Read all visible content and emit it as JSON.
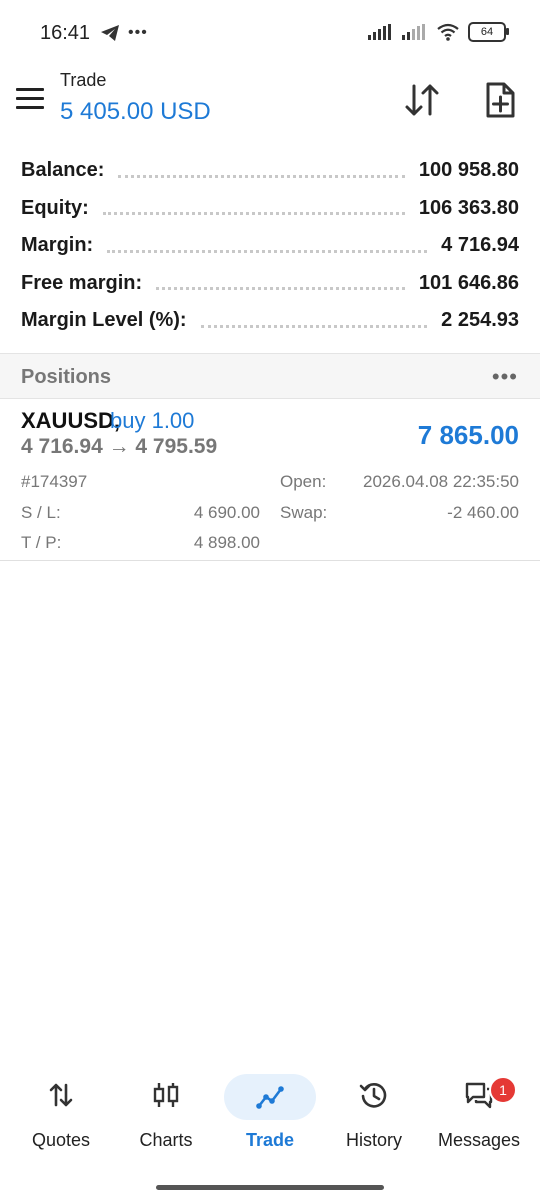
{
  "status_bar": {
    "time": "16:41",
    "battery": "64"
  },
  "header": {
    "title": "Trade",
    "subtitle": "5 405.00 USD"
  },
  "summary": [
    {
      "label": "Balance:",
      "value": "100 958.80"
    },
    {
      "label": "Equity:",
      "value": "106 363.80"
    },
    {
      "label": "Margin:",
      "value": "4 716.94"
    },
    {
      "label": "Free margin:",
      "value": "101 646.86"
    },
    {
      "label": "Margin Level (%):",
      "value": "2 254.93"
    }
  ],
  "positions": {
    "title": "Positions",
    "more": "•••",
    "item": {
      "symbol": "XAUUSD,",
      "side": "buy 1.00",
      "prices": "4 716.94 → 4 795.59",
      "profit": "7 865.00",
      "ticket": "#174397",
      "open_label": "Open:",
      "open_value": "2026.04.08 22:35:50",
      "sl_label": "S / L:",
      "sl_value": "4 690.00",
      "swap_label": "Swap:",
      "swap_value": "-2 460.00",
      "tp_label": "T / P:",
      "tp_value": "4 898.00"
    }
  },
  "nav": [
    {
      "label": "Quotes",
      "icon": "quotes-arrows-icon"
    },
    {
      "label": "Charts",
      "icon": "candlestick-icon"
    },
    {
      "label": "Trade",
      "icon": "trade-line-icon",
      "active": true
    },
    {
      "label": "History",
      "icon": "history-icon"
    },
    {
      "label": "Messages",
      "icon": "messages-icon",
      "badge": "1"
    }
  ],
  "colors": {
    "accent": "#1e7ad6",
    "badge": "#e53935"
  }
}
